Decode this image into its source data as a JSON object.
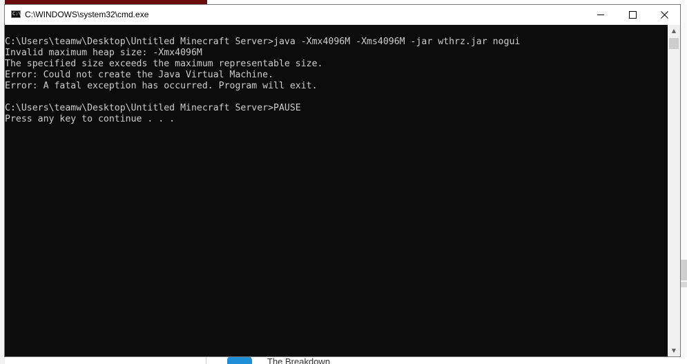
{
  "window": {
    "title": "C:\\WINDOWS\\system32\\cmd.exe",
    "icon": "cmd-app-icon",
    "controls": [
      "minimize-icon",
      "maximize-icon",
      "close-icon"
    ]
  },
  "console": {
    "lines": [
      "C:\\Users\\teamw\\Desktop\\Untitled Minecraft Server>java -Xmx4096M -Xms4096M -jar wthrz.jar nogui",
      "Invalid maximum heap size: -Xmx4096M",
      "The specified size exceeds the maximum representable size.",
      "Error: Could not create the Java Virtual Machine.",
      "Error: A fatal exception has occurred. Program will exit.",
      "",
      "C:\\Users\\teamw\\Desktop\\Untitled Minecraft Server>PAUSE",
      "Press any key to continue . . ."
    ]
  },
  "background": {
    "bottom_text": "The Breakdown"
  },
  "colors": {
    "console_bg": "#0c0c0c",
    "console_fg": "#cccccc",
    "titlebar_bg": "#ffffff"
  }
}
